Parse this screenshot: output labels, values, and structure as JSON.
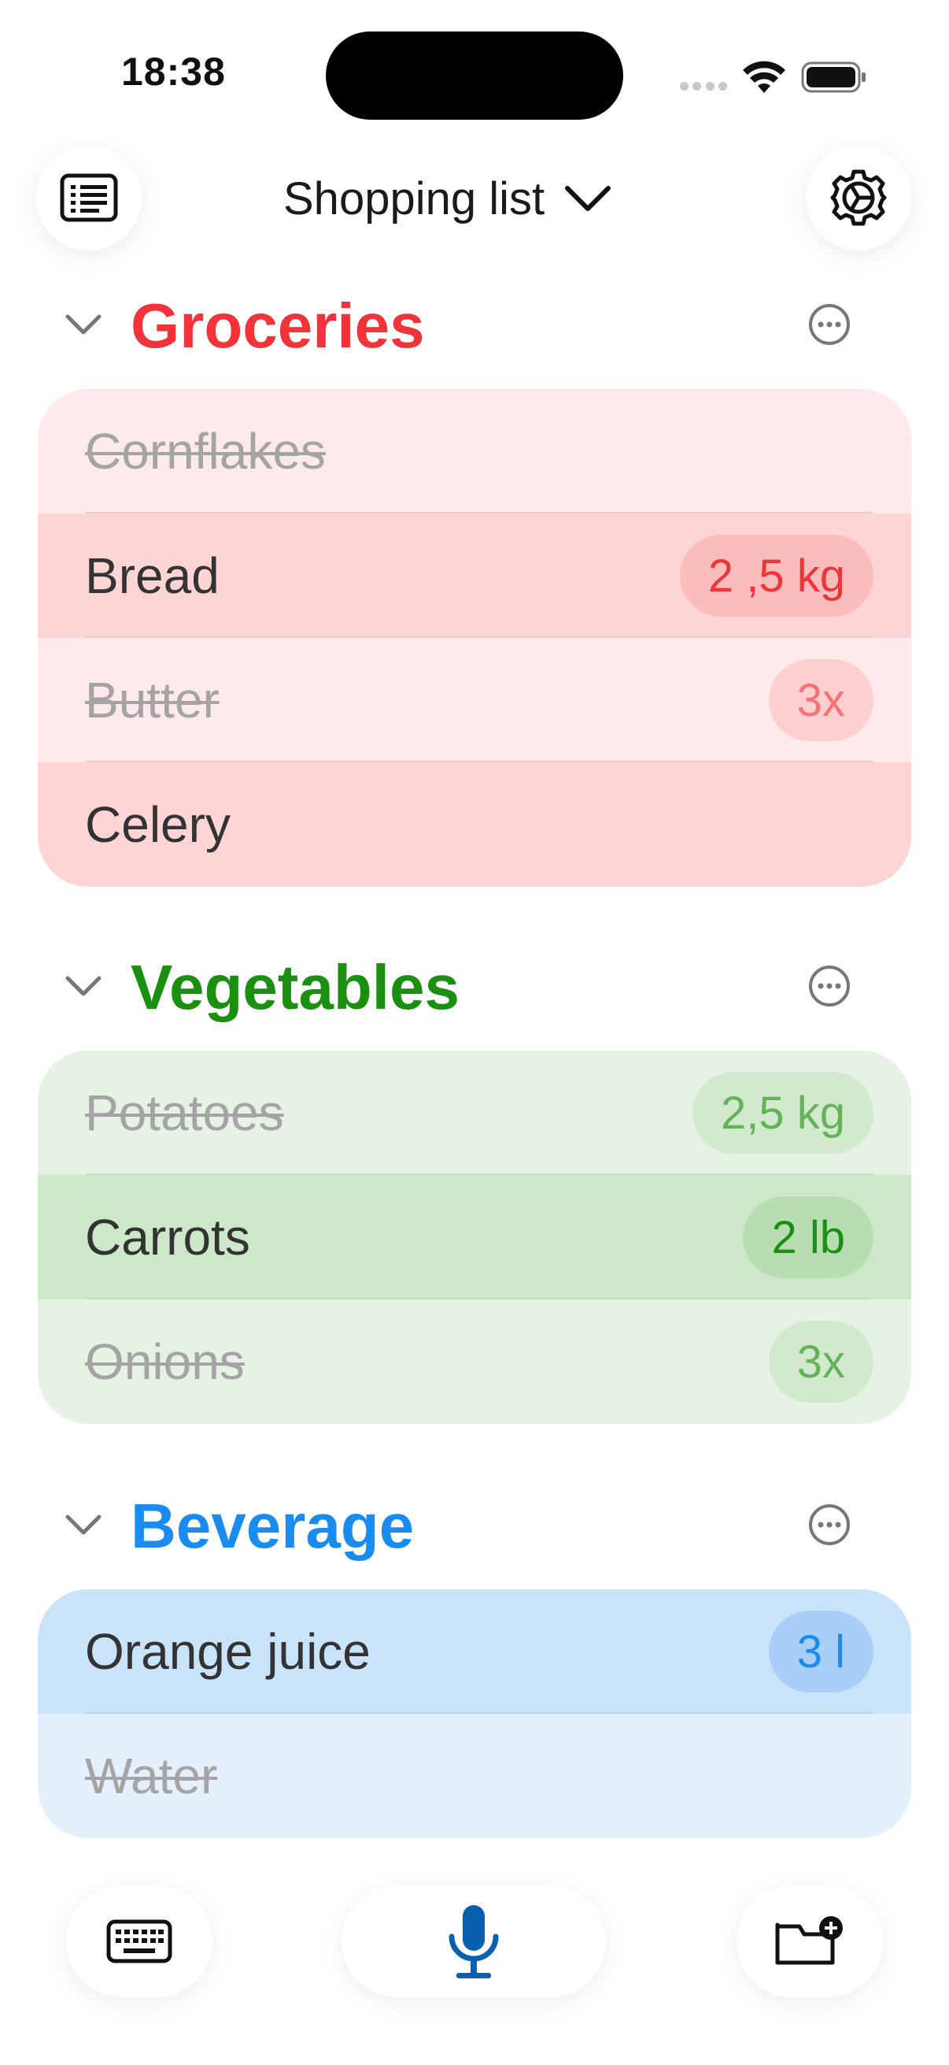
{
  "status_bar": {
    "time": "18:38"
  },
  "header": {
    "title": "Shopping list"
  },
  "colors": {
    "groceries": "#f2343a",
    "vegetables": "#1a8f10",
    "beverage": "#1a8cf0"
  },
  "sections": [
    {
      "name": "Groceries",
      "items": [
        {
          "label": "Cornflakes",
          "done": true,
          "qty": ""
        },
        {
          "label": "Bread",
          "done": false,
          "qty": "2 ,5 kg"
        },
        {
          "label": "Butter",
          "done": true,
          "qty": "3x"
        },
        {
          "label": "Celery",
          "done": false,
          "qty": ""
        }
      ]
    },
    {
      "name": "Vegetables",
      "items": [
        {
          "label": "Potatoes",
          "done": true,
          "qty": "2,5 kg"
        },
        {
          "label": "Carrots",
          "done": false,
          "qty": "2 lb"
        },
        {
          "label": "Onions",
          "done": true,
          "qty": "3x"
        }
      ]
    },
    {
      "name": "Beverage",
      "items": [
        {
          "label": "Orange juice",
          "done": false,
          "qty": "3 l"
        },
        {
          "label": "Water",
          "done": true,
          "qty": ""
        }
      ]
    }
  ],
  "bottom_bar": {
    "left_icon": "keyboard-icon",
    "center_icon": "microphone-icon",
    "right_icon": "folder-add-icon"
  }
}
